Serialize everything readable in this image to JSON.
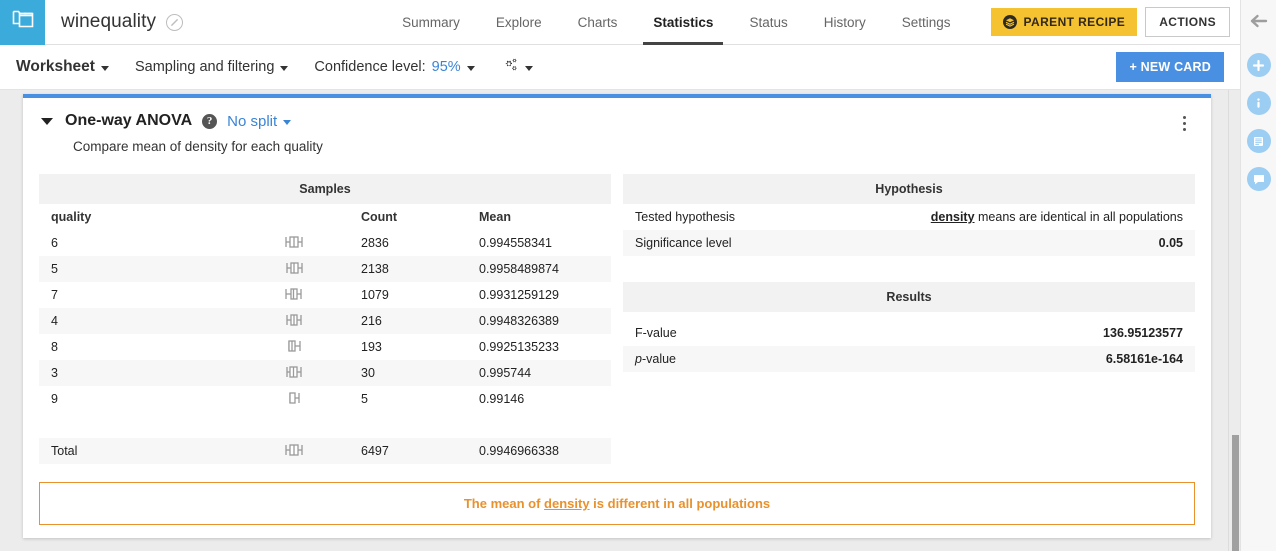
{
  "header": {
    "logo_icon": "folder-stack-icon",
    "project_title": "winequality",
    "title_badge_icon": "circle-slash-icon",
    "tabs": [
      {
        "label": "Summary",
        "active": false
      },
      {
        "label": "Explore",
        "active": false
      },
      {
        "label": "Charts",
        "active": false
      },
      {
        "label": "Statistics",
        "active": true
      },
      {
        "label": "Status",
        "active": false
      },
      {
        "label": "History",
        "active": false
      },
      {
        "label": "Settings",
        "active": false
      }
    ],
    "parent_recipe_label": "PARENT RECIPE",
    "parent_recipe_icon": "layers-icon",
    "actions_label": "ACTIONS",
    "parent_recipe_color": "#f5c231"
  },
  "toolbar": {
    "worksheet_label": "Worksheet",
    "sampling_label": "Sampling and filtering",
    "confidence_label": "Confidence level:",
    "confidence_value": "95%",
    "gear_icon": "gears-icon",
    "new_card_label": "+ NEW CARD",
    "new_card_color": "#4a90e2"
  },
  "card": {
    "collapse_icon": "chevron-down-icon",
    "title": "One-way ANOVA",
    "help_icon": "question-mark-icon",
    "help_glyph": "?",
    "split_label": "No split",
    "subtitle": "Compare mean of density for each quality",
    "menu_icon": "kebab-menu-icon",
    "accent_color": "#4a90e2"
  },
  "samples": {
    "section_title": "Samples",
    "columns": [
      "quality",
      "",
      "Count",
      "Mean"
    ],
    "rows": [
      {
        "quality": "6",
        "plot": "boxplot-icon",
        "count": "2836",
        "mean": "0.994558341"
      },
      {
        "quality": "5",
        "plot": "boxplot-icon",
        "count": "2138",
        "mean": "0.9958489874"
      },
      {
        "quality": "7",
        "plot": "boxplot-icon",
        "count": "1079",
        "mean": "0.9931259129"
      },
      {
        "quality": "4",
        "plot": "boxplot-icon",
        "count": "216",
        "mean": "0.9948326389"
      },
      {
        "quality": "8",
        "plot": "boxplot-icon",
        "count": "193",
        "mean": "0.9925135233"
      },
      {
        "quality": "3",
        "plot": "boxplot-icon",
        "count": "30",
        "mean": "0.995744"
      },
      {
        "quality": "9",
        "plot": "boxplot-icon",
        "count": "5",
        "mean": "0.99146"
      }
    ],
    "total": {
      "quality": "Total",
      "plot": "boxplot-icon",
      "count": "6497",
      "mean": "0.9946966338"
    }
  },
  "hypothesis": {
    "section_title": "Hypothesis",
    "tested_label": "Tested hypothesis",
    "tested_variable": "density",
    "tested_rest": " means are identical in all populations",
    "significance_label": "Significance level",
    "significance_value": "0.05"
  },
  "results": {
    "section_title": "Results",
    "f_label": "F-value",
    "f_value": "136.95123577",
    "p_label_italic": "p",
    "p_label_rest": "-value",
    "p_value": "6.58161e-164",
    "p_value_color": "#e8912d"
  },
  "conclusion": {
    "prefix": "The mean of ",
    "variable": "density",
    "suffix": " is different in all populations",
    "color": "#e8912d"
  },
  "rail": {
    "items": [
      {
        "icon": "back-arrow-icon"
      },
      {
        "icon": "plus-icon"
      },
      {
        "icon": "info-icon"
      },
      {
        "icon": "details-list-icon"
      },
      {
        "icon": "chat-bubble-icon"
      }
    ],
    "accent_color": "#9ccdf2"
  }
}
